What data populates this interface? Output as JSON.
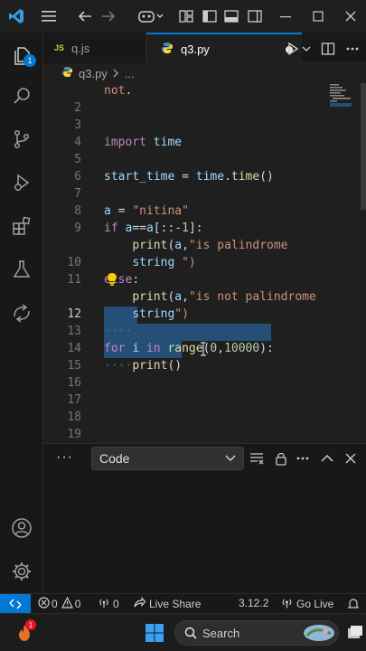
{
  "tabs": [
    {
      "label": "q.js",
      "icon": "js-file-icon",
      "badge": "JS"
    },
    {
      "label": "q3.py",
      "icon": "python-file-icon"
    }
  ],
  "breadcrumb": {
    "file": "q3.py",
    "ellipsis": "..."
  },
  "explorer_badge": "1",
  "editor": {
    "lines": [
      {
        "n": "",
        "text": "not."
      },
      {
        "n": "2",
        "text": ""
      },
      {
        "n": "3",
        "text": "import time"
      },
      {
        "n": "4",
        "text": ""
      },
      {
        "n": "5",
        "text": "start_time = time.time()"
      },
      {
        "n": "6",
        "text": ""
      },
      {
        "n": "7",
        "text": "a = \"nitina\""
      },
      {
        "n": "8",
        "text": "if a==a[::-1]:"
      },
      {
        "n": "9",
        "text": "    print(a,\"is palindrome"
      },
      {
        "n": "",
        "text": "    string \")"
      },
      {
        "n": "10",
        "text": "else:"
      },
      {
        "n": "11",
        "text": "    print(a,\"is not palindrome"
      },
      {
        "n": "",
        "text": "    string\")"
      },
      {
        "n": "12",
        "text": "    "
      },
      {
        "n": "13",
        "text": "for i in range(0,10000):"
      },
      {
        "n": "14",
        "text": "    print()"
      },
      {
        "n": "15",
        "text": ""
      },
      {
        "n": "16",
        "text": ""
      },
      {
        "n": "17",
        "text": ""
      },
      {
        "n": "18",
        "text": ""
      },
      {
        "n": "19",
        "text": ""
      }
    ],
    "current_line": "12"
  },
  "panel": {
    "more": "···",
    "select_value": "Code"
  },
  "status": {
    "errors": "0",
    "warnings": "0",
    "ports": "0",
    "live_share": "Live Share",
    "python_version": "3.12.2",
    "go_live": "Go Live"
  },
  "taskbar": {
    "search_placeholder": "Search",
    "notification_count": "1"
  },
  "colors": {
    "accent": "#0078d4",
    "keyword": "#c586c0",
    "function": "#dcdcaa",
    "variable": "#9cdcfe",
    "string": "#ce9178",
    "number": "#b5cea8",
    "selection": "#264f78"
  }
}
